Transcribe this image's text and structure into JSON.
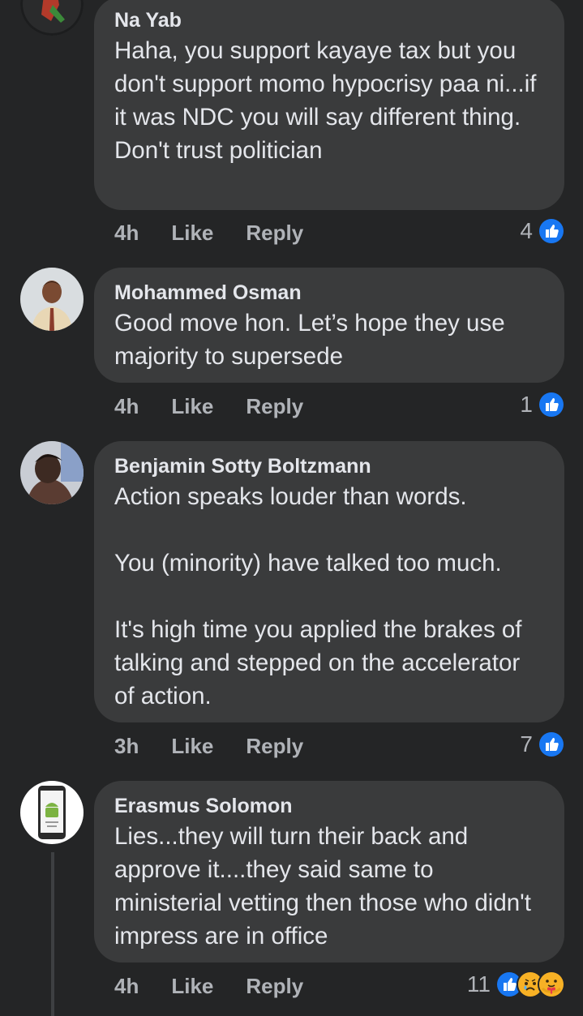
{
  "comments": [
    {
      "author": "Na Yab",
      "text": "Haha, you support kayaye tax but you don't support momo hypocrisy paa ni...if it was NDC you will say different thing.\nDon't trust politician",
      "time": "4h",
      "like_label": "Like",
      "reply_label": "Reply",
      "reaction_count": "4",
      "reactions": [
        "like-icon"
      ]
    },
    {
      "author": "Mohammed Osman",
      "text": "Good move hon. Let’s hope they use majority to supersede",
      "time": "4h",
      "like_label": "Like",
      "reply_label": "Reply",
      "reaction_count": "1",
      "reactions": [
        "like-icon"
      ]
    },
    {
      "author": "Benjamin Sotty Boltzmann",
      "text": "Action speaks louder than words.\n\nYou (minority) have talked too much.\n\nIt's high time you applied the brakes of talking and stepped on the accelerator of action.",
      "time": "3h",
      "like_label": "Like",
      "reply_label": "Reply",
      "reaction_count": "7",
      "reactions": [
        "like-icon"
      ]
    },
    {
      "author": "Erasmus Solomon",
      "text": "Lies...they will turn their back and approve it....they said same to ministerial vetting then those who didn't impress are in office",
      "time": "4h",
      "like_label": "Like",
      "reply_label": "Reply",
      "reaction_count": "11",
      "reactions": [
        "like-icon",
        "sad-icon",
        "care-icon"
      ]
    }
  ],
  "colors": {
    "background": "#242526",
    "bubble": "#3a3b3c",
    "text": "#e4e6eb",
    "muted": "#b0b3b8",
    "like_blue": "#1877f2"
  }
}
